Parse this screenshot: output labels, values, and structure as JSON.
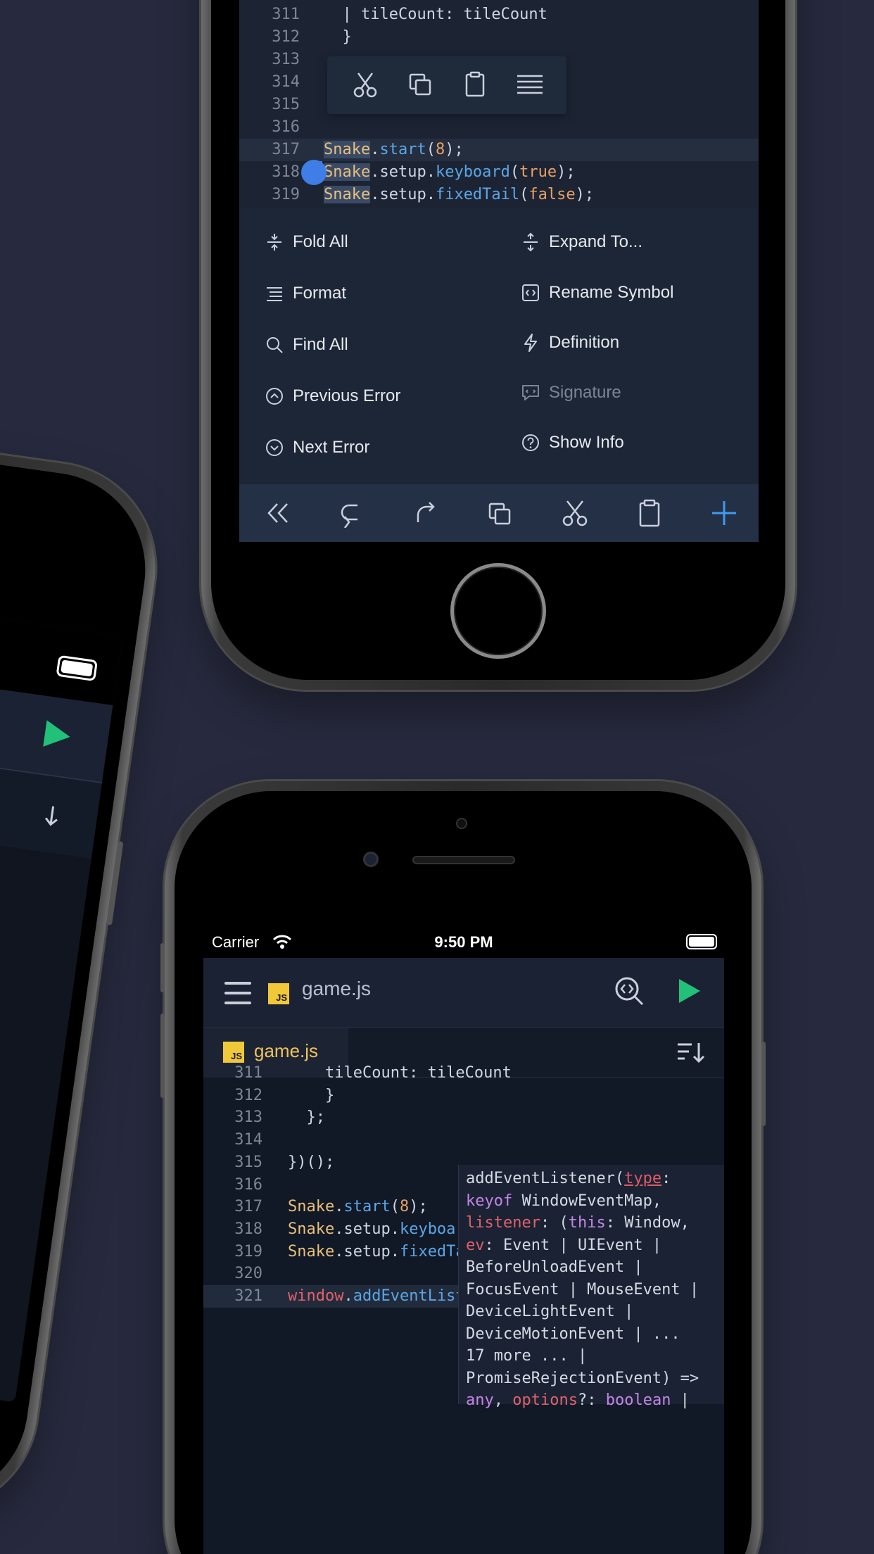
{
  "top_phone": {
    "code_lines": [
      {
        "n": "311",
        "segments": [
          {
            "t": "  | tileCount: tileCount",
            "c": ""
          }
        ]
      },
      {
        "n": "312",
        "segments": [
          {
            "t": "  }",
            "c": ""
          }
        ]
      },
      {
        "n": "313",
        "segments": [
          {
            "t": "",
            "c": ""
          }
        ]
      },
      {
        "n": "314",
        "segments": [
          {
            "t": "",
            "c": ""
          }
        ]
      },
      {
        "n": "315",
        "segments": [
          {
            "t": "",
            "c": ""
          }
        ]
      },
      {
        "n": "316",
        "segments": [
          {
            "t": "",
            "c": ""
          }
        ]
      },
      {
        "n": "317",
        "segments": [
          {
            "t": "Snake",
            "c": "yel sel"
          },
          {
            "t": ".",
            "c": ""
          },
          {
            "t": "start",
            "c": "blu"
          },
          {
            "t": "(",
            "c": ""
          },
          {
            "t": "8",
            "c": "org"
          },
          {
            "t": ");",
            "c": ""
          }
        ]
      },
      {
        "n": "318",
        "segments": [
          {
            "t": "Snake",
            "c": "yel sel"
          },
          {
            "t": ".setup.",
            "c": ""
          },
          {
            "t": "keyboard",
            "c": "blu"
          },
          {
            "t": "(",
            "c": ""
          },
          {
            "t": "true",
            "c": "org"
          },
          {
            "t": ");",
            "c": ""
          }
        ]
      },
      {
        "n": "319",
        "segments": [
          {
            "t": "Snake",
            "c": "yel sel"
          },
          {
            "t": ".setup.",
            "c": ""
          },
          {
            "t": "fixedTail",
            "c": "blu"
          },
          {
            "t": "(",
            "c": ""
          },
          {
            "t": "false",
            "c": "org"
          },
          {
            "t": ");",
            "c": ""
          }
        ]
      }
    ],
    "menu": {
      "left": [
        "Fold All",
        "Format",
        "Find All",
        "Previous Error",
        "Next Error"
      ],
      "right": [
        "Expand To...",
        "Rename Symbol",
        "Definition",
        "Signature",
        "Show Info"
      ]
    }
  },
  "bottom_phone": {
    "status": {
      "carrier": "Carrier",
      "time": "9:50 PM"
    },
    "header_title": "game.js",
    "tab_label": "game.js",
    "js_badge": "JS",
    "code_lines": [
      {
        "n": "311",
        "segments": [
          {
            "t": "    tileCount: tileCount",
            "c": ""
          }
        ]
      },
      {
        "n": "312",
        "segments": [
          {
            "t": "    }",
            "c": ""
          }
        ]
      },
      {
        "n": "313",
        "segments": [
          {
            "t": "  };",
            "c": ""
          }
        ]
      },
      {
        "n": "314",
        "segments": [
          {
            "t": "",
            "c": ""
          }
        ]
      },
      {
        "n": "315",
        "segments": [
          {
            "t": "})();",
            "c": ""
          }
        ]
      },
      {
        "n": "316",
        "segments": [
          {
            "t": "",
            "c": ""
          }
        ]
      },
      {
        "n": "317",
        "segments": [
          {
            "t": "Snake",
            "c": "yel"
          },
          {
            "t": ".",
            "c": ""
          },
          {
            "t": "start",
            "c": "blu"
          },
          {
            "t": "(",
            "c": ""
          },
          {
            "t": "8",
            "c": "org"
          },
          {
            "t": ");",
            "c": ""
          }
        ]
      },
      {
        "n": "318",
        "segments": [
          {
            "t": "Snake",
            "c": "yel"
          },
          {
            "t": ".setup.",
            "c": ""
          },
          {
            "t": "keyboard",
            "c": "blu"
          },
          {
            "t": "(",
            "c": ""
          },
          {
            "t": "true",
            "c": "org"
          },
          {
            "t": ");",
            "c": ""
          }
        ]
      },
      {
        "n": "319",
        "segments": [
          {
            "t": "Snake",
            "c": "yel"
          },
          {
            "t": ".setup.",
            "c": ""
          },
          {
            "t": "fixedTail",
            "c": "blu"
          },
          {
            "t": "(",
            "c": ""
          },
          {
            "t": "false",
            "c": "org"
          },
          {
            "t": ");",
            "c": ""
          }
        ]
      },
      {
        "n": "320",
        "segments": [
          {
            "t": "",
            "c": ""
          }
        ]
      },
      {
        "n": "321",
        "segments": [
          {
            "t": "window",
            "c": "red"
          },
          {
            "t": ".",
            "c": ""
          },
          {
            "t": "addEventListener",
            "c": "blu"
          },
          {
            "t": "()",
            "c": ""
          }
        ]
      }
    ],
    "signature_hint": [
      [
        {
          "t": "addEventListener(",
          "c": ""
        },
        {
          "t": "type",
          "c": "type"
        },
        {
          "t": ":",
          "c": ""
        }
      ],
      [
        {
          "t": "keyof",
          "c": "pur"
        },
        {
          "t": " WindowEventMap,",
          "c": ""
        }
      ],
      [
        {
          "t": "listener",
          "c": "red"
        },
        {
          "t": ": (",
          "c": ""
        },
        {
          "t": "this",
          "c": "pur"
        },
        {
          "t": ": Window,",
          "c": ""
        }
      ],
      [
        {
          "t": "ev",
          "c": "red"
        },
        {
          "t": ": Event | UIEvent |",
          "c": ""
        }
      ],
      [
        {
          "t": "BeforeUnloadEvent |",
          "c": ""
        }
      ],
      [
        {
          "t": "FocusEvent | MouseEvent |",
          "c": ""
        }
      ],
      [
        {
          "t": "DeviceLightEvent |",
          "c": ""
        }
      ],
      [
        {
          "t": "DeviceMotionEvent | ...",
          "c": ""
        }
      ],
      [
        {
          "t": "17 more ... |",
          "c": ""
        }
      ],
      [
        {
          "t": "PromiseRejectionEvent) =>",
          "c": ""
        }
      ],
      [
        {
          "t": "any",
          "c": "pur"
        },
        {
          "t": ", ",
          "c": ""
        },
        {
          "t": "options",
          "c": "red"
        },
        {
          "t": "?: ",
          "c": ""
        },
        {
          "t": "boolean",
          "c": "pur"
        },
        {
          "t": " |",
          "c": ""
        }
      ]
    ]
  },
  "colors": {
    "accent_blue": "#3e7ee6",
    "run_green": "#21c17a",
    "tab_yellow": "#f0c25c",
    "background": "#272a3e"
  }
}
